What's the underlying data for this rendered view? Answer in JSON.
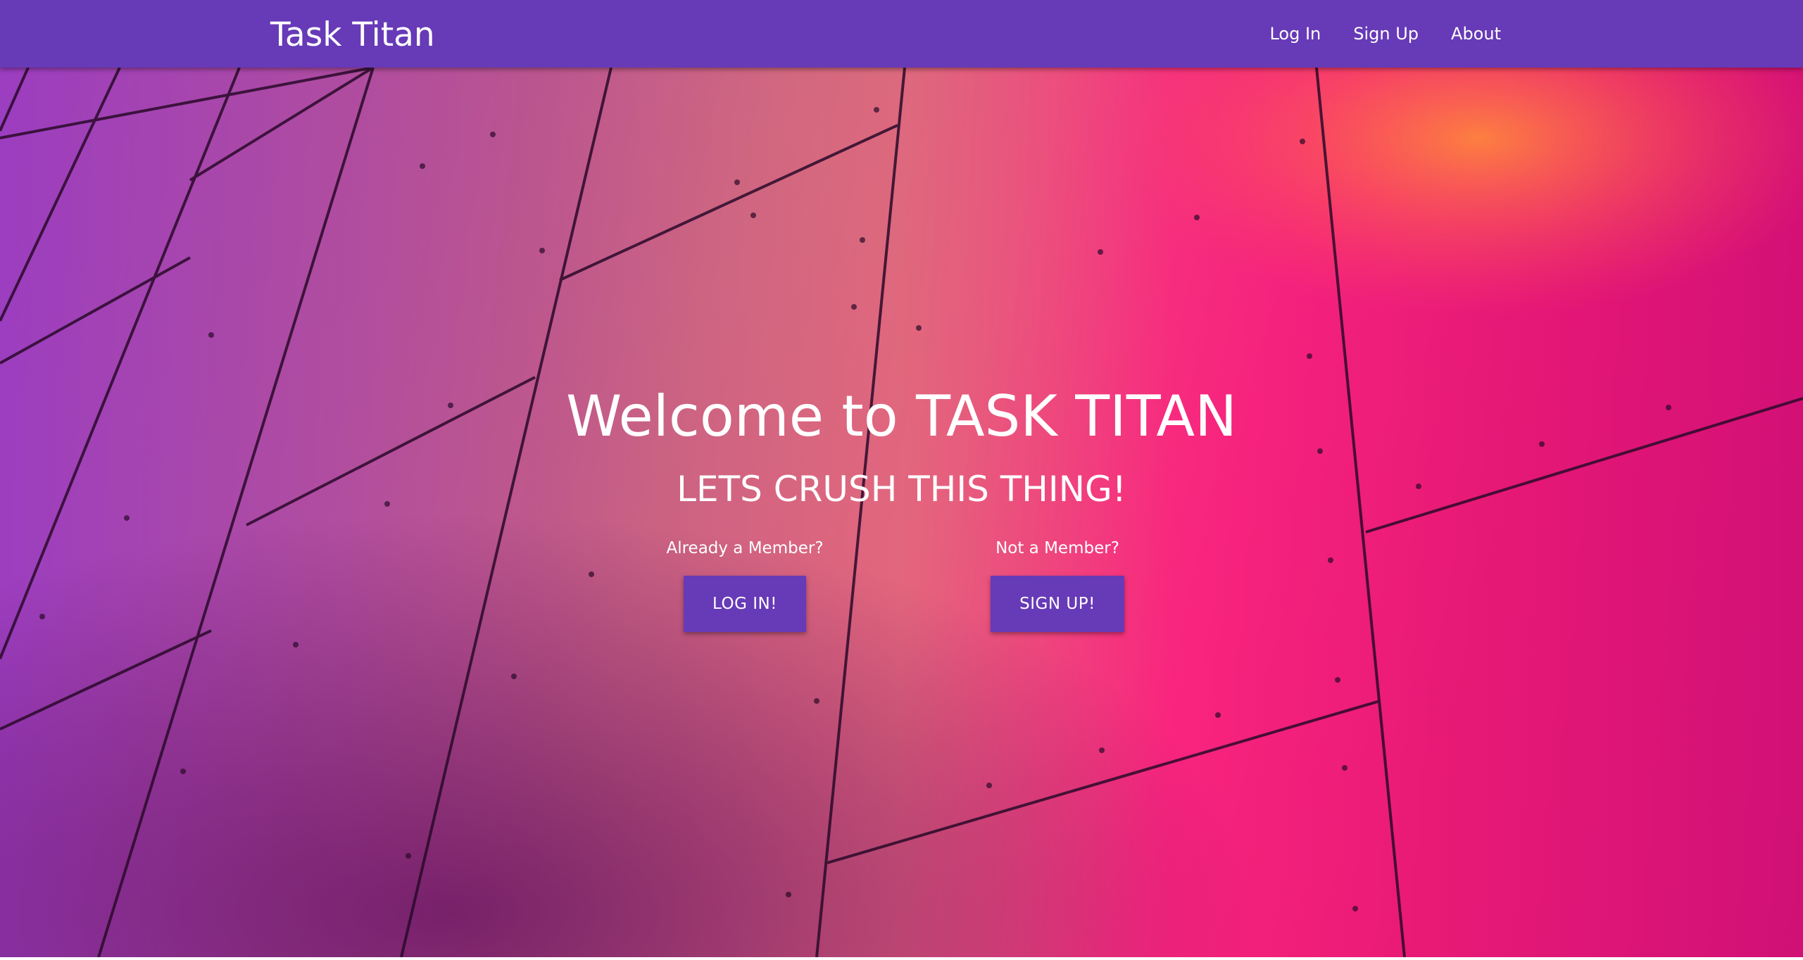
{
  "navbar": {
    "brand": "Task Titan",
    "links": [
      "Log In",
      "Sign Up",
      "About"
    ],
    "color": "#673ab7"
  },
  "hero": {
    "title": "Welcome to TASK TITAN",
    "subtitle": "LETS CRUSH THIS THING!",
    "login": {
      "label": "Already a Member?",
      "button": "LOG IN!"
    },
    "signup": {
      "label": "Not a Member?",
      "button": "SIGN UP!"
    },
    "background_image": "abstract-magenta-metal-panels"
  }
}
